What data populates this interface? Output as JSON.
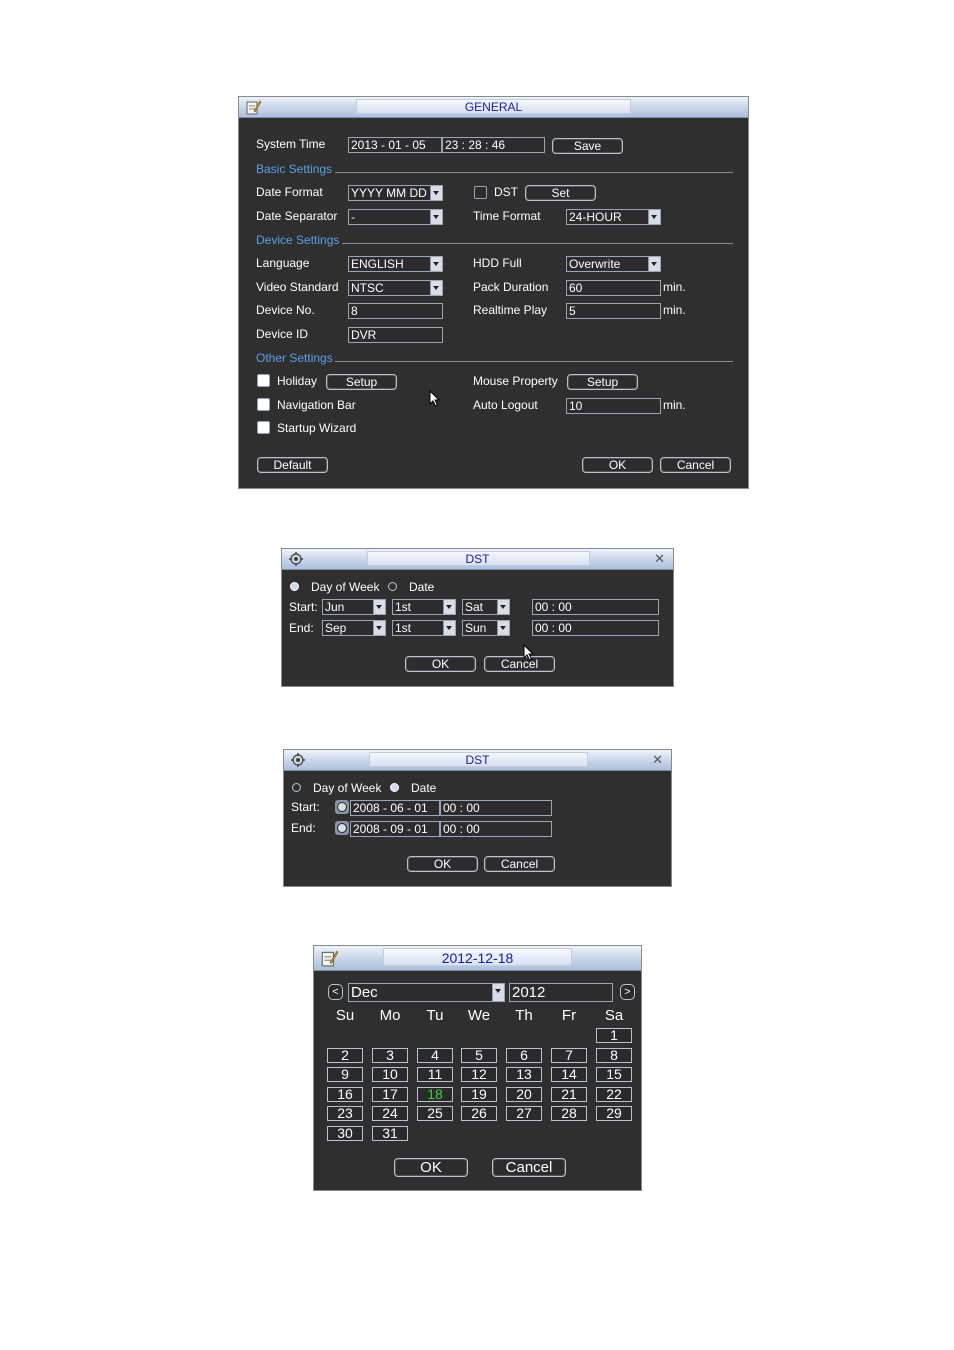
{
  "general": {
    "title": "GENERAL",
    "system_time": {
      "label": "System Time",
      "date": "2013  - 01 - 05",
      "time": "23 : 28 : 46",
      "save": "Save"
    },
    "basic_settings": "Basic Settings",
    "date_format": {
      "label": "Date Format",
      "value": "YYYY MM DD"
    },
    "dst": {
      "label": "DST",
      "set": "Set"
    },
    "date_separator": {
      "label": "Date Separator",
      "value": "-"
    },
    "time_format": {
      "label": "Time Format",
      "value": "24-HOUR"
    },
    "device_settings": "Device Settings",
    "language": {
      "label": "Language",
      "value": "ENGLISH"
    },
    "hdd_full": {
      "label": "HDD Full",
      "value": "Overwrite"
    },
    "video_standard": {
      "label": "Video Standard",
      "value": "NTSC"
    },
    "pack_duration": {
      "label": "Pack Duration",
      "value": "60",
      "unit": "min."
    },
    "device_no": {
      "label": "Device No.",
      "value": "8"
    },
    "realtime_play": {
      "label": "Realtime Play",
      "value": "5",
      "unit": "min."
    },
    "device_id": {
      "label": "Device ID",
      "value": "DVR"
    },
    "other_settings": "Other Settings",
    "holiday": {
      "label": "Holiday",
      "setup": "Setup"
    },
    "mouse_property": {
      "label": "Mouse Property",
      "setup": "Setup"
    },
    "navigation_bar": {
      "label": "Navigation Bar"
    },
    "auto_logout": {
      "label": "Auto Logout",
      "value": "10",
      "unit": "min."
    },
    "startup_wizard": {
      "label": "Startup Wizard"
    },
    "default": "Default",
    "ok": "OK",
    "cancel": "Cancel"
  },
  "dst_week": {
    "title": "DST",
    "mode_week": "Day of Week",
    "mode_date": "Date",
    "start_label": "Start:",
    "end_label": "End:",
    "start": {
      "month": "Jun",
      "week": "1st",
      "day": "Sat",
      "time": "00  : 00"
    },
    "end": {
      "month": "Sep",
      "week": "1st",
      "day": "Sun",
      "time": "00  : 00"
    },
    "ok": "OK",
    "cancel": "Cancel"
  },
  "dst_date": {
    "title": "DST",
    "mode_week": "Day of Week",
    "mode_date": "Date",
    "start_label": "Start:",
    "end_label": "End:",
    "start": {
      "date": "2008  - 06 - 01",
      "time": "00 : 00"
    },
    "end": {
      "date": "2008  - 09 - 01",
      "time": "00 : 00"
    },
    "ok": "OK",
    "cancel": "Cancel"
  },
  "calendar": {
    "title": "2012-12-18",
    "month": "Dec",
    "year": "2012",
    "prev": "<",
    "next": ">",
    "weekdays": [
      "Su",
      "Mo",
      "Tu",
      "We",
      "Th",
      "Fr",
      "Sa"
    ],
    "d1": "1",
    "d2": "2",
    "d3": "3",
    "d4": "4",
    "d5": "5",
    "d6": "6",
    "d7": "7",
    "d8": "8",
    "d9": "9",
    "d10": "10",
    "d11": "11",
    "d12": "12",
    "d13": "13",
    "d14": "14",
    "d15": "15",
    "d16": "16",
    "d17": "17",
    "d18": "18",
    "d19": "19",
    "d20": "20",
    "d21": "21",
    "d22": "22",
    "d23": "23",
    "d24": "24",
    "d25": "25",
    "d26": "26",
    "d27": "27",
    "d28": "28",
    "d29": "29",
    "d30": "30",
    "d31": "31",
    "ok": "OK",
    "cancel": "Cancel"
  },
  "colors": {
    "window_bg": "#2f2f2f",
    "section_blue": "#5aa0e8",
    "title_blue": "#1a1aa8",
    "today_green": "#3cd23c"
  }
}
